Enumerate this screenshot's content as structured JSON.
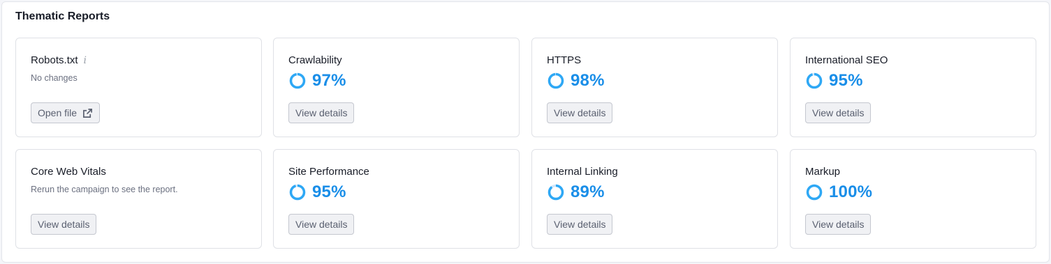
{
  "section": {
    "title": "Thematic Reports"
  },
  "accent_color": "#1a8ee8",
  "ring_color": "#2ea8f5",
  "robots": {
    "title": "Robots.txt",
    "info_icon": "info-icon",
    "subtitle": "No changes",
    "button": "Open file",
    "button_icon": "external-link-icon"
  },
  "crawlability": {
    "title": "Crawlability",
    "percent_label": "97%",
    "percent": 97,
    "button": "View details"
  },
  "https": {
    "title": "HTTPS",
    "percent_label": "98%",
    "percent": 98,
    "button": "View details"
  },
  "international_seo": {
    "title": "International SEO",
    "percent_label": "95%",
    "percent": 95,
    "button": "View details"
  },
  "core_web_vitals": {
    "title": "Core Web Vitals",
    "subtitle": "Rerun the campaign to see the report.",
    "button": "View details"
  },
  "site_performance": {
    "title": "Site Performance",
    "percent_label": "95%",
    "percent": 95,
    "button": "View details"
  },
  "internal_linking": {
    "title": "Internal Linking",
    "percent_label": "89%",
    "percent": 89,
    "button": "View details"
  },
  "markup": {
    "title": "Markup",
    "percent_label": "100%",
    "percent": 100,
    "button": "View details"
  }
}
